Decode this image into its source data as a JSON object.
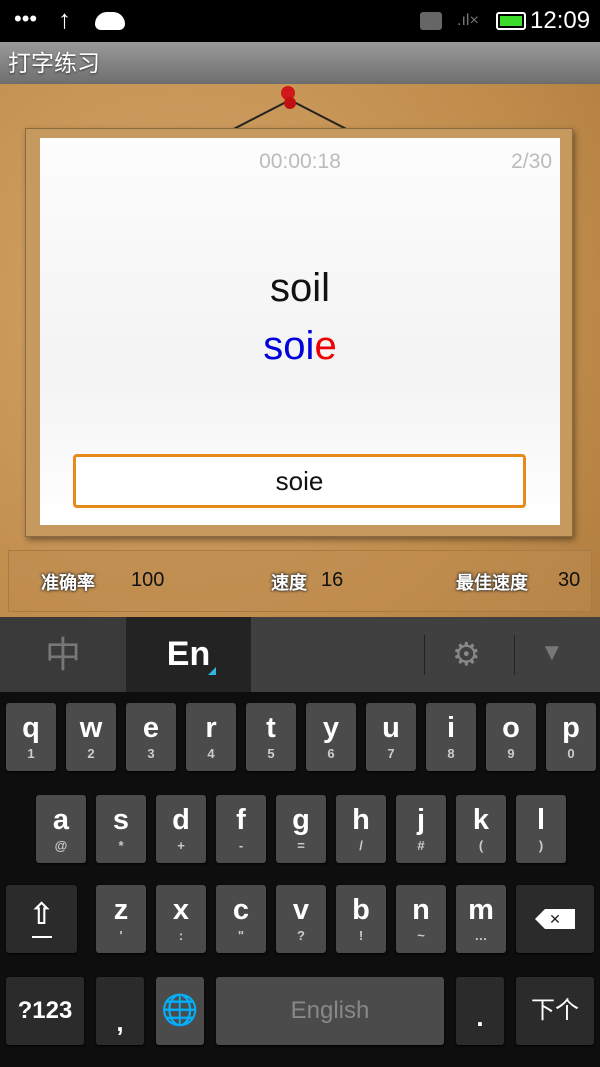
{
  "status_bar": {
    "time": "12:09",
    "colors": {
      "battery": "#3ddc2a"
    }
  },
  "app": {
    "title": "打字练习"
  },
  "card": {
    "timer": "00:00:18",
    "progress": "2/30",
    "target_word": "soil",
    "typed_correct": "soi",
    "typed_wrong": "e",
    "input_value": "soie",
    "colors": {
      "correct": "#0000dd",
      "wrong": "#ee0000",
      "input_border": "#e88a1a"
    }
  },
  "stats": {
    "accuracy_label": "准确率",
    "accuracy": "100",
    "speed_label": "速度",
    "speed": "16",
    "best_label": "最佳速度",
    "best": "30"
  },
  "keyboard": {
    "tabs": {
      "chinese": "中",
      "english": "En"
    },
    "row1": [
      [
        "q",
        "1"
      ],
      [
        "w",
        "2"
      ],
      [
        "e",
        "3"
      ],
      [
        "r",
        "4"
      ],
      [
        "t",
        "5"
      ],
      [
        "y",
        "6"
      ],
      [
        "u",
        "7"
      ],
      [
        "i",
        "8"
      ],
      [
        "o",
        "9"
      ],
      [
        "p",
        "0"
      ]
    ],
    "row2": [
      [
        "a",
        "@"
      ],
      [
        "s",
        "*"
      ],
      [
        "d",
        "+"
      ],
      [
        "f",
        "-"
      ],
      [
        "g",
        "="
      ],
      [
        "h",
        "/"
      ],
      [
        "j",
        "#"
      ],
      [
        "k",
        "("
      ],
      [
        "l",
        ")"
      ]
    ],
    "row3": [
      [
        "z",
        "'"
      ],
      [
        "x",
        ":"
      ],
      [
        "c",
        "\""
      ],
      [
        "v",
        "?"
      ],
      [
        "b",
        "!"
      ],
      [
        "n",
        "~"
      ],
      [
        "m",
        "…"
      ]
    ],
    "symbols_key": "?123",
    "comma": ",",
    "space": "English",
    "period": ".",
    "next_key": "下个",
    "more": "…"
  }
}
